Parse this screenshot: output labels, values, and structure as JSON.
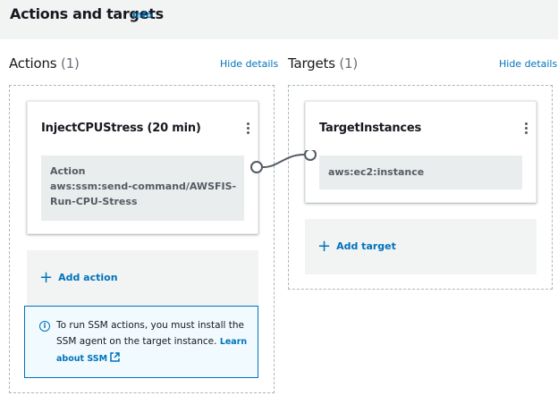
{
  "header": {
    "title": "Actions and targets",
    "info_label": "Info"
  },
  "actions_section": {
    "label": "Actions",
    "count": "(1)",
    "hide_details_label": "Hide details",
    "card": {
      "title": "InjectCPUStress (20 min)",
      "detail_label": "Action",
      "detail_value_line1": "aws:ssm:send-command/AWSFIS-",
      "detail_value_line2": "Run-CPU-Stress"
    },
    "add_label": "Add action",
    "info_alert": {
      "text": "To run SSM actions, you must install the SSM agent on the target instance.",
      "link_label": "Learn about SSM"
    }
  },
  "targets_section": {
    "label": "Targets",
    "count": "(1)",
    "hide_details_label": "Hide details",
    "card": {
      "title": "TargetInstances",
      "detail_value": "aws:ec2:instance"
    },
    "add_label": "Add target"
  },
  "colors": {
    "link": "#0073bb",
    "header_bg": "#f2f3f3",
    "info_bg": "#f1faff"
  }
}
